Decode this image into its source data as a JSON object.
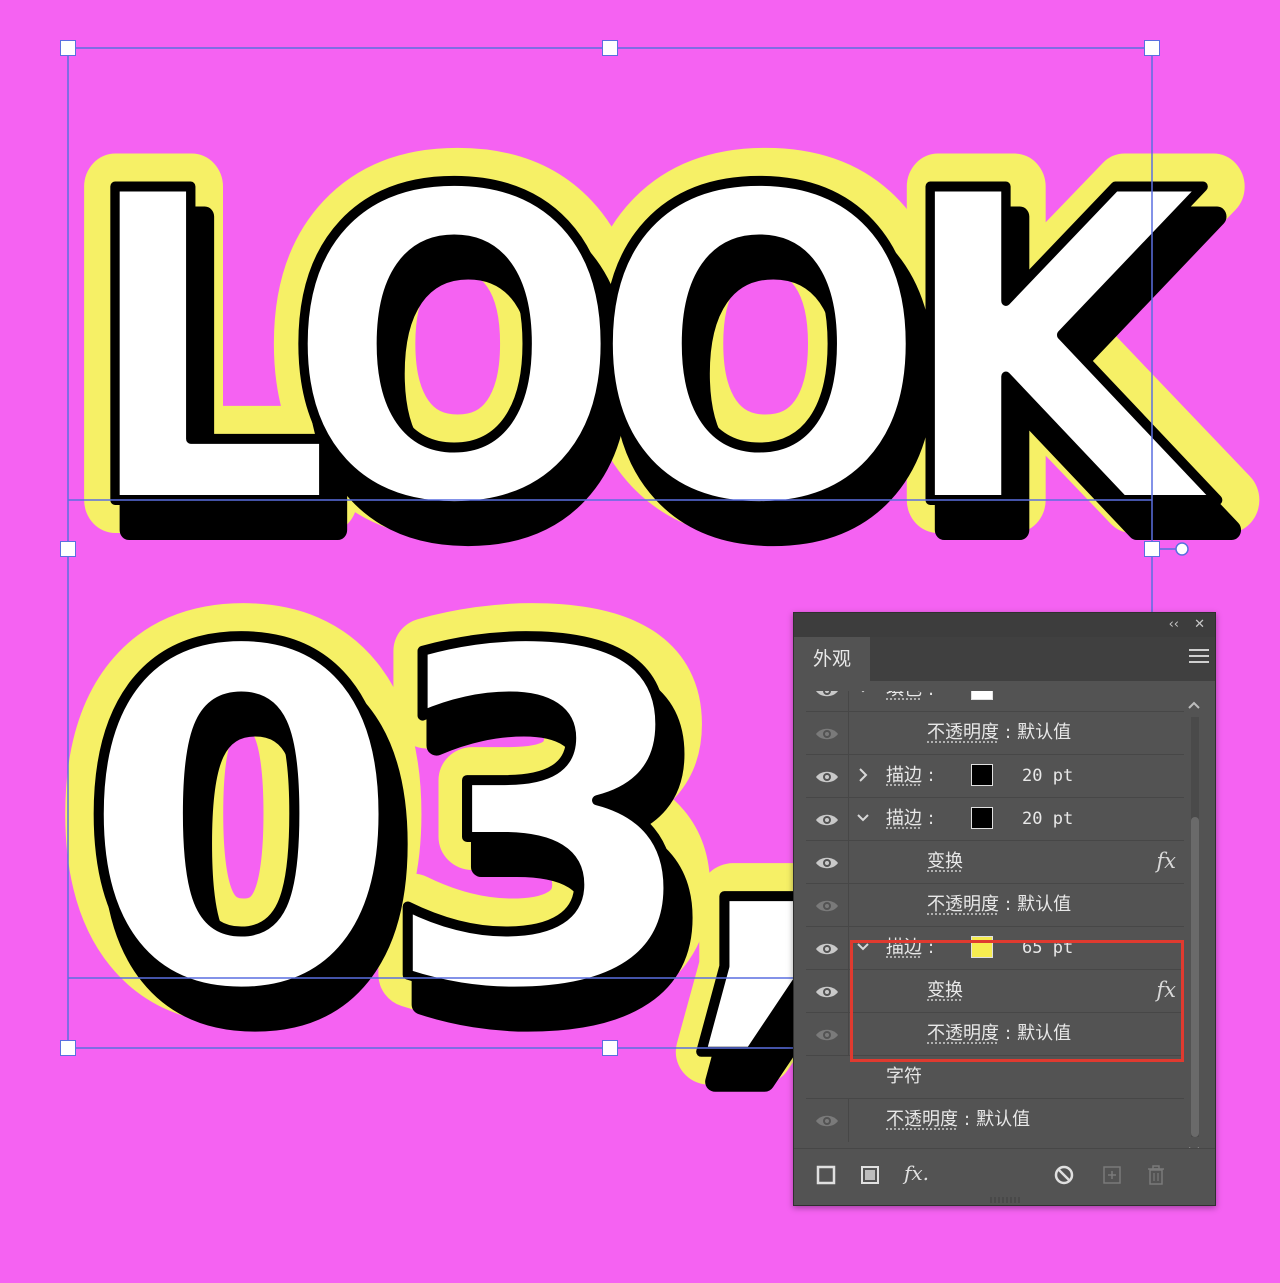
{
  "artboard": {
    "background": "#f562f2",
    "line1": "LOOK",
    "line2": "03,",
    "colors": {
      "fill": "#ffffff",
      "stroke": "#000000",
      "outline": "#f6f066",
      "selection": "#5a6fe0"
    }
  },
  "panel": {
    "tab": "外观",
    "collapse_glyph": "‹‹",
    "close_glyph": "✕",
    "rows": [
      {
        "type": "fill",
        "label": "填色",
        "colon": ":",
        "swatch": "#ffffff",
        "chevron": "down"
      },
      {
        "type": "opacity",
        "label": "不透明度",
        "colon": ":",
        "value": "默认值",
        "dimmed_eye": true
      },
      {
        "type": "stroke",
        "label": "描边",
        "colon": ":",
        "swatch": "#000000",
        "size": "20 pt",
        "chevron": "right"
      },
      {
        "type": "stroke",
        "label": "描边",
        "colon": ":",
        "swatch": "#000000",
        "size": "20 pt",
        "chevron": "down"
      },
      {
        "type": "effect",
        "label": "变换",
        "fx": "fx"
      },
      {
        "type": "opacity",
        "label": "不透明度",
        "colon": ":",
        "value": "默认值",
        "dimmed_eye": true
      },
      {
        "type": "stroke",
        "label": "描边",
        "colon": ":",
        "swatch": "#f6ec50",
        "size": "65 pt",
        "chevron": "down"
      },
      {
        "type": "effect",
        "label": "变换",
        "fx": "fx"
      },
      {
        "type": "opacity",
        "label": "不透明度",
        "colon": ":",
        "value": "默认值",
        "dimmed_eye": true
      },
      {
        "type": "section",
        "label": "字符"
      },
      {
        "type": "opacity-top",
        "label": "不透明度",
        "colon": ":",
        "value": "默认值",
        "dimmed_eye": true
      }
    ],
    "footer": {
      "add_stroke_icon": "square-outline-icon",
      "add_fill_icon": "square-filled-icon",
      "fx_label": "fx.",
      "clear_icon": "no-icon",
      "duplicate_icon": "duplicate-icon",
      "delete_icon": "trash-icon"
    },
    "highlight_color": "#e03a2f"
  }
}
